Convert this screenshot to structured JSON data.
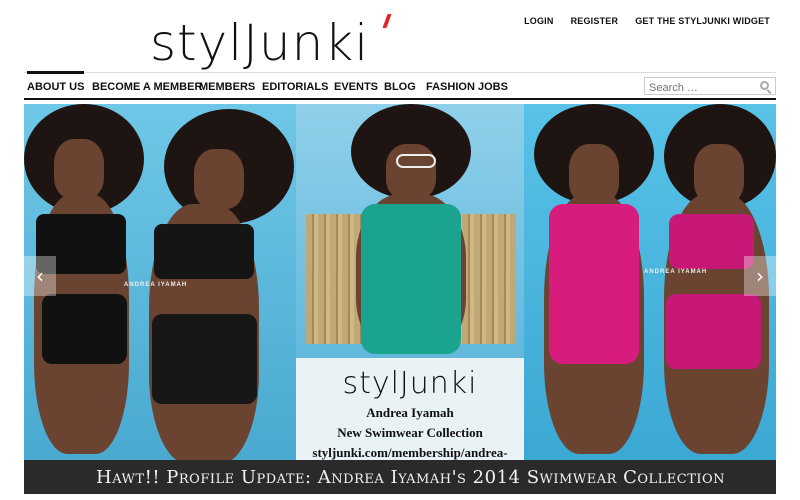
{
  "header": {
    "logo_text": "stylJunki",
    "top_links": [
      "LOGIN",
      "REGISTER",
      "GET THE STYLJUNKI WIDGET"
    ]
  },
  "nav": {
    "items": [
      "ABOUT US",
      "BECOME A MEMBER",
      "MEMBERS",
      "EDITORIALS",
      "EVENTS",
      "BLOG",
      "FASHION JOBS"
    ],
    "active": "ABOUT US"
  },
  "search": {
    "placeholder": "Search …"
  },
  "slider": {
    "caption_logo": "stylJunki",
    "caption_lines": [
      "Andrea Iyamah",
      "New Swimwear Collection",
      "styljunki.com/membership/andrea-iyamah"
    ],
    "watermark": "ANDREA IYAMAH",
    "prev_icon": "‹",
    "next_icon": "›",
    "title": "Hawt!! Profile Update: Andrea Iyamah's 2014 Swimwear Collection"
  },
  "colors": {
    "accent_red": "#e0262b",
    "title_bar": "#2a2a2a",
    "backdrop_blue": "#5ab6d8",
    "teal_suit": "#1aa38f",
    "magenta_suit": "#d81c7e"
  }
}
